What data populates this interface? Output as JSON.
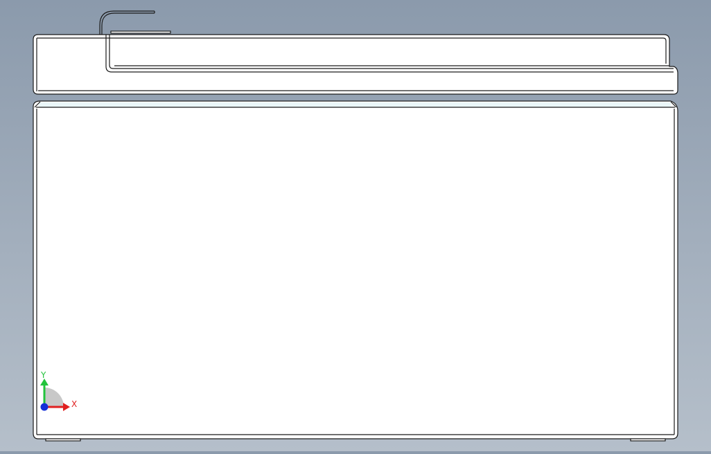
{
  "viewport": {
    "background_top": "#8b9aac",
    "background_bottom": "#b5bfca"
  },
  "model": {
    "face_fill": "#ffffff",
    "edge_color": "#1a1a1a",
    "accent_band": "#eaf6f8"
  },
  "triad": {
    "x_label": "X",
    "y_label": "Y",
    "x_color": "#e02020",
    "y_color": "#22c33c",
    "z_color": "#1530d8"
  }
}
